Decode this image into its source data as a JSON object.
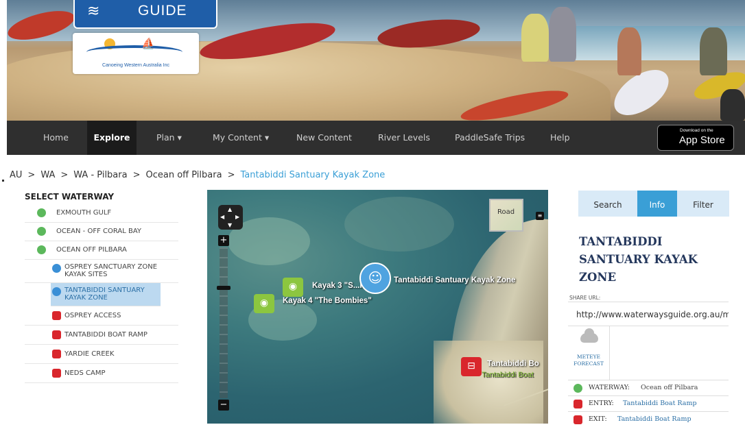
{
  "header": {
    "guide_text": "GUIDE",
    "org_logo_text": "Canoeing Western Australia Inc"
  },
  "nav": {
    "items": [
      {
        "label": "Home"
      },
      {
        "label": "Explore"
      },
      {
        "label": "Plan ▾"
      },
      {
        "label": "My Content ▾"
      },
      {
        "label": "New Content"
      },
      {
        "label": "River Levels"
      },
      {
        "label": "PaddleSafe Trips"
      },
      {
        "label": "Help"
      }
    ],
    "active": "Explore",
    "app_store": {
      "small": "Download on the",
      "big": "App Store"
    }
  },
  "breadcrumb": [
    "AU",
    "WA",
    "WA - Pilbara",
    "Ocean off Pilbara",
    "Tantabiddi Santuary Kayak Zone"
  ],
  "breadcrumb_separator": ">",
  "sidebar": {
    "title": "SELECT WATERWAY",
    "items": [
      {
        "label": "EXMOUTH GULF",
        "level": 1,
        "icon": "waterway-icon"
      },
      {
        "label": "OCEAN - OFF CORAL BAY",
        "level": 1,
        "icon": "waterway-icon"
      },
      {
        "label": "OCEAN OFF PILBARA",
        "level": 1,
        "icon": "waterway-icon"
      },
      {
        "label": "OSPREY SANCTUARY ZONE KAYAK SITES",
        "level": 2,
        "icon": "kayak-zone-icon"
      },
      {
        "label": "TANTABIDDI SANTUARY KAYAK ZONE",
        "level": 2,
        "icon": "kayak-zone-icon",
        "selected": true
      },
      {
        "label": "OSPREY ACCESS",
        "level": 3,
        "icon": "car-access-icon"
      },
      {
        "label": "TANTABIDDI BOAT RAMP",
        "level": 3,
        "icon": "car-access-icon"
      },
      {
        "label": "YARDIE CREEK",
        "level": 3,
        "icon": "car-access-icon"
      },
      {
        "label": "NEDS CAMP",
        "level": 3,
        "icon": "car-access-icon"
      }
    ]
  },
  "map": {
    "layer_button": "Road",
    "zoom_in": "+",
    "zoom_out": "−",
    "markers": [
      {
        "label": "Kayak 3 \"S...ns\"",
        "icon": "camera-icon"
      },
      {
        "label": "Kayak 4 \"The Bombies\"",
        "icon": "camera-icon"
      },
      {
        "label": "Tantabiddi Santuary Kayak Zone",
        "icon": "kayaker-icon"
      },
      {
        "label": "Tantabiddi Bo",
        "sublabel": "Tantabiddi Boat",
        "icon": "car-icon"
      }
    ]
  },
  "info": {
    "tabs": [
      {
        "label": "Search"
      },
      {
        "label": "Info"
      },
      {
        "label": "Filter"
      }
    ],
    "active_tab": "Info",
    "title": "TANTABIDDI SANTUARY KAYAK ZONE",
    "share_label": "SHARE URL:",
    "share_url": "http://www.waterwaysguide.org.au/m",
    "meteye": "METEYE FORECAST",
    "meta": [
      {
        "key": "WATERWAY:",
        "value": "Ocean off Pilbara",
        "link": false
      },
      {
        "key": "ENTRY:",
        "value": "Tantabiddi Boat Ramp",
        "link": true
      },
      {
        "key": "EXIT:",
        "value": "Tantabiddi Boat Ramp",
        "link": true
      }
    ]
  },
  "colors": {
    "nav_bg": "#2f2f2f",
    "accent_blue": "#3a9fd6",
    "waterway_green": "#5cb85c",
    "access_red": "#d9262c",
    "title_navy": "#24375c"
  }
}
